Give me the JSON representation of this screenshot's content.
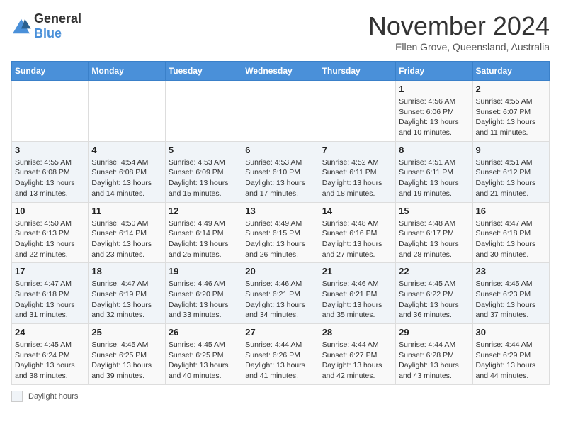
{
  "header": {
    "logo_general": "General",
    "logo_blue": "Blue",
    "month_title": "November 2024",
    "subtitle": "Ellen Grove, Queensland, Australia"
  },
  "weekdays": [
    "Sunday",
    "Monday",
    "Tuesday",
    "Wednesday",
    "Thursday",
    "Friday",
    "Saturday"
  ],
  "weeks": [
    [
      {
        "day": "",
        "info": ""
      },
      {
        "day": "",
        "info": ""
      },
      {
        "day": "",
        "info": ""
      },
      {
        "day": "",
        "info": ""
      },
      {
        "day": "",
        "info": ""
      },
      {
        "day": "1",
        "info": "Sunrise: 4:56 AM\nSunset: 6:06 PM\nDaylight: 13 hours and 10 minutes."
      },
      {
        "day": "2",
        "info": "Sunrise: 4:55 AM\nSunset: 6:07 PM\nDaylight: 13 hours and 11 minutes."
      }
    ],
    [
      {
        "day": "3",
        "info": "Sunrise: 4:55 AM\nSunset: 6:08 PM\nDaylight: 13 hours and 13 minutes."
      },
      {
        "day": "4",
        "info": "Sunrise: 4:54 AM\nSunset: 6:08 PM\nDaylight: 13 hours and 14 minutes."
      },
      {
        "day": "5",
        "info": "Sunrise: 4:53 AM\nSunset: 6:09 PM\nDaylight: 13 hours and 15 minutes."
      },
      {
        "day": "6",
        "info": "Sunrise: 4:53 AM\nSunset: 6:10 PM\nDaylight: 13 hours and 17 minutes."
      },
      {
        "day": "7",
        "info": "Sunrise: 4:52 AM\nSunset: 6:11 PM\nDaylight: 13 hours and 18 minutes."
      },
      {
        "day": "8",
        "info": "Sunrise: 4:51 AM\nSunset: 6:11 PM\nDaylight: 13 hours and 19 minutes."
      },
      {
        "day": "9",
        "info": "Sunrise: 4:51 AM\nSunset: 6:12 PM\nDaylight: 13 hours and 21 minutes."
      }
    ],
    [
      {
        "day": "10",
        "info": "Sunrise: 4:50 AM\nSunset: 6:13 PM\nDaylight: 13 hours and 22 minutes."
      },
      {
        "day": "11",
        "info": "Sunrise: 4:50 AM\nSunset: 6:14 PM\nDaylight: 13 hours and 23 minutes."
      },
      {
        "day": "12",
        "info": "Sunrise: 4:49 AM\nSunset: 6:14 PM\nDaylight: 13 hours and 25 minutes."
      },
      {
        "day": "13",
        "info": "Sunrise: 4:49 AM\nSunset: 6:15 PM\nDaylight: 13 hours and 26 minutes."
      },
      {
        "day": "14",
        "info": "Sunrise: 4:48 AM\nSunset: 6:16 PM\nDaylight: 13 hours and 27 minutes."
      },
      {
        "day": "15",
        "info": "Sunrise: 4:48 AM\nSunset: 6:17 PM\nDaylight: 13 hours and 28 minutes."
      },
      {
        "day": "16",
        "info": "Sunrise: 4:47 AM\nSunset: 6:18 PM\nDaylight: 13 hours and 30 minutes."
      }
    ],
    [
      {
        "day": "17",
        "info": "Sunrise: 4:47 AM\nSunset: 6:18 PM\nDaylight: 13 hours and 31 minutes."
      },
      {
        "day": "18",
        "info": "Sunrise: 4:47 AM\nSunset: 6:19 PM\nDaylight: 13 hours and 32 minutes."
      },
      {
        "day": "19",
        "info": "Sunrise: 4:46 AM\nSunset: 6:20 PM\nDaylight: 13 hours and 33 minutes."
      },
      {
        "day": "20",
        "info": "Sunrise: 4:46 AM\nSunset: 6:21 PM\nDaylight: 13 hours and 34 minutes."
      },
      {
        "day": "21",
        "info": "Sunrise: 4:46 AM\nSunset: 6:21 PM\nDaylight: 13 hours and 35 minutes."
      },
      {
        "day": "22",
        "info": "Sunrise: 4:45 AM\nSunset: 6:22 PM\nDaylight: 13 hours and 36 minutes."
      },
      {
        "day": "23",
        "info": "Sunrise: 4:45 AM\nSunset: 6:23 PM\nDaylight: 13 hours and 37 minutes."
      }
    ],
    [
      {
        "day": "24",
        "info": "Sunrise: 4:45 AM\nSunset: 6:24 PM\nDaylight: 13 hours and 38 minutes."
      },
      {
        "day": "25",
        "info": "Sunrise: 4:45 AM\nSunset: 6:25 PM\nDaylight: 13 hours and 39 minutes."
      },
      {
        "day": "26",
        "info": "Sunrise: 4:45 AM\nSunset: 6:25 PM\nDaylight: 13 hours and 40 minutes."
      },
      {
        "day": "27",
        "info": "Sunrise: 4:44 AM\nSunset: 6:26 PM\nDaylight: 13 hours and 41 minutes."
      },
      {
        "day": "28",
        "info": "Sunrise: 4:44 AM\nSunset: 6:27 PM\nDaylight: 13 hours and 42 minutes."
      },
      {
        "day": "29",
        "info": "Sunrise: 4:44 AM\nSunset: 6:28 PM\nDaylight: 13 hours and 43 minutes."
      },
      {
        "day": "30",
        "info": "Sunrise: 4:44 AM\nSunset: 6:29 PM\nDaylight: 13 hours and 44 minutes."
      }
    ]
  ],
  "footer": {
    "daylight_label": "Daylight hours"
  }
}
